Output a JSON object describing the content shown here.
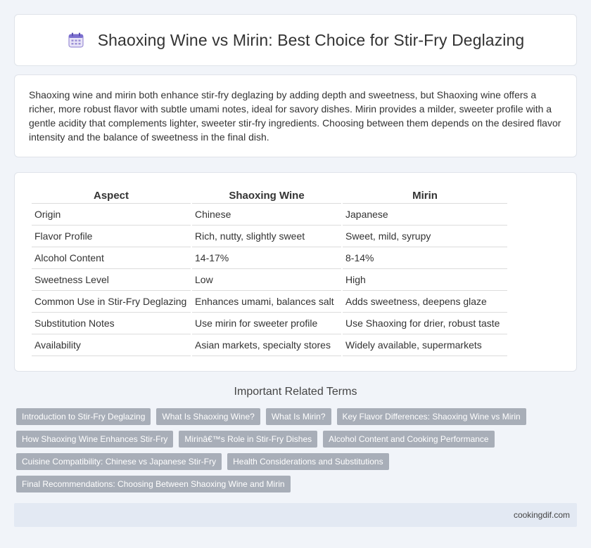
{
  "header": {
    "title": "Shaoxing Wine vs Mirin: Best Choice for Stir-Fry Deglazing",
    "icon": "calendar-icon"
  },
  "intro": {
    "text": "Shaoxing wine and mirin both enhance stir-fry deglazing by adding depth and sweetness, but Shaoxing wine offers a richer, more robust flavor with subtle umami notes, ideal for savory dishes. Mirin provides a milder, sweeter profile with a gentle acidity that complements lighter, sweeter stir-fry ingredients. Choosing between them depends on the desired flavor intensity and the balance of sweetness in the final dish."
  },
  "table": {
    "headers": [
      "Aspect",
      "Shaoxing Wine",
      "Mirin"
    ],
    "rows": [
      [
        "Origin",
        "Chinese",
        "Japanese"
      ],
      [
        "Flavor Profile",
        "Rich, nutty, slightly sweet",
        "Sweet, mild, syrupy"
      ],
      [
        "Alcohol Content",
        "14-17%",
        "8-14%"
      ],
      [
        "Sweetness Level",
        "Low",
        "High"
      ],
      [
        "Common Use in Stir-Fry Deglazing",
        "Enhances umami, balances salt",
        "Adds sweetness, deepens glaze"
      ],
      [
        "Substitution Notes",
        "Use mirin for sweeter profile",
        "Use Shaoxing for drier, robust taste"
      ],
      [
        "Availability",
        "Asian markets, specialty stores",
        "Widely available, supermarkets"
      ]
    ]
  },
  "related": {
    "title": "Important Related Terms",
    "rows": [
      [
        "Introduction to Stir-Fry Deglazing",
        "What Is Shaoxing Wine?",
        "What Is Mirin?",
        "Key Flavor Differences: Shaoxing Wine vs Mirin"
      ],
      [
        "How Shaoxing Wine Enhances Stir-Fry",
        "Mirinâ€™s Role in Stir-Fry Dishes",
        "Alcohol Content and Cooking Performance"
      ],
      [
        "Cuisine Compatibility: Chinese vs Japanese Stir-Fry",
        "Health Considerations and Substitutions"
      ],
      [
        "Final Recommendations: Choosing Between Shaoxing Wine and Mirin"
      ]
    ]
  },
  "footer": {
    "site": "cookingdif.com"
  }
}
